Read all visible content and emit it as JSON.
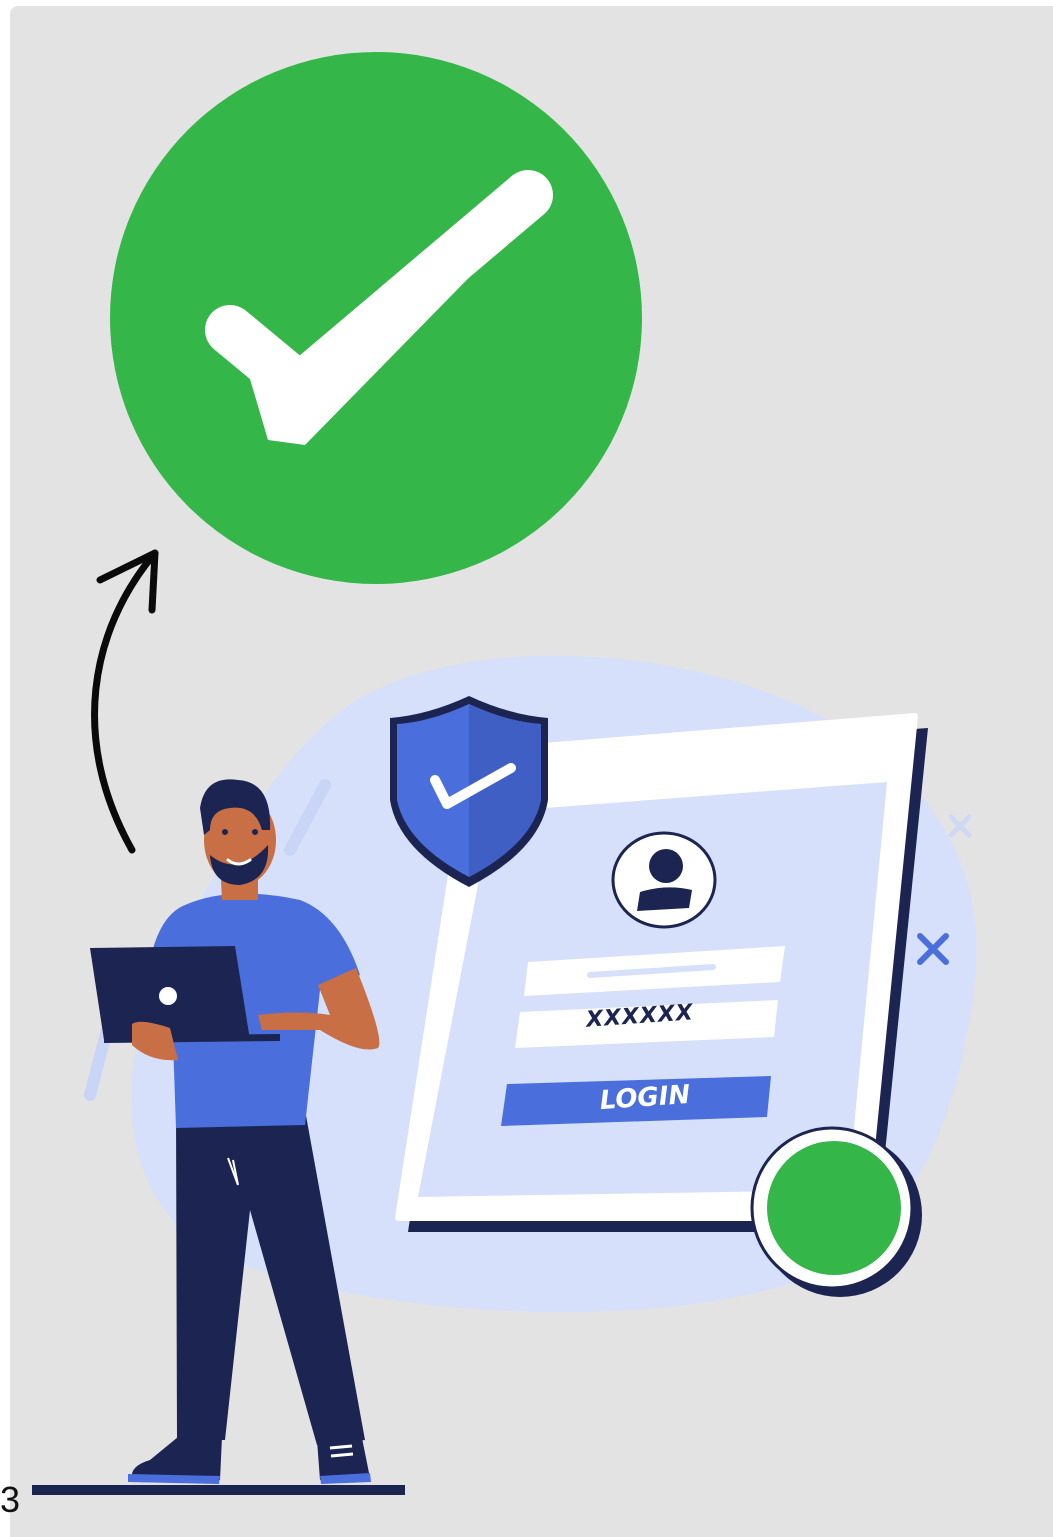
{
  "login_form": {
    "username_placeholder": "",
    "password_value": "XXXXXX",
    "login_label": "LOGIN"
  },
  "corner_text": "3",
  "icons": {
    "success": "green-check-circle-icon",
    "shield": "shield-check-icon",
    "user": "user-avatar-icon",
    "arrow": "curved-arrow-icon",
    "close": "x-mark-icon"
  },
  "colors": {
    "success_green": "#34b648",
    "primary_blue": "#4a6fdc",
    "navy": "#1c2452",
    "light_blue": "#d7e1fb",
    "background": "#e3e3e3"
  }
}
